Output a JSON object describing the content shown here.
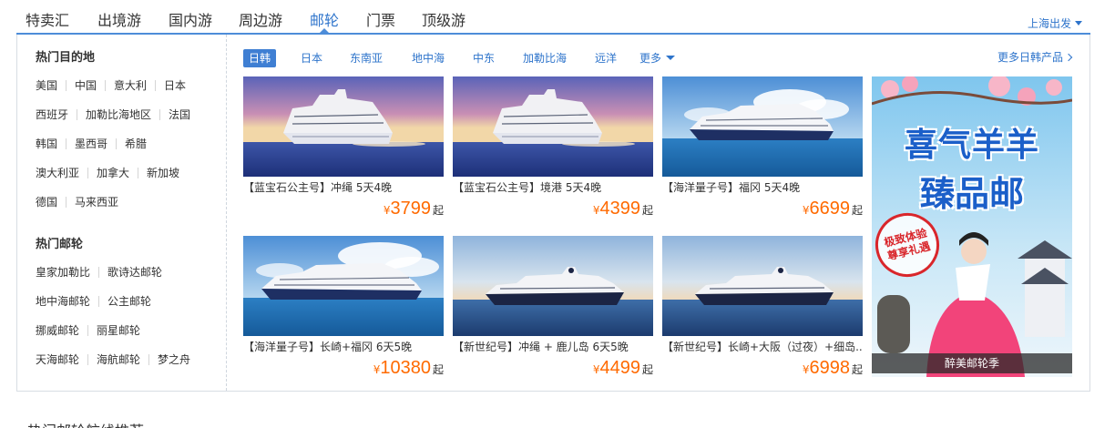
{
  "topnav": {
    "tabs": [
      "特卖汇",
      "出境游",
      "国内游",
      "周边游",
      "邮轮",
      "门票",
      "顶级游"
    ],
    "active_tab": "邮轮",
    "departure": "上海出发"
  },
  "sidebar": {
    "destinations_title": "热门目的地",
    "destinations": [
      [
        "美国",
        "中国",
        "意大利",
        "日本"
      ],
      [
        "西班牙",
        "加勒比海地区",
        "法国"
      ],
      [
        "韩国",
        "墨西哥",
        "希腊"
      ],
      [
        "澳大利亚",
        "加拿大",
        "新加坡"
      ],
      [
        "德国",
        "马来西亚"
      ]
    ],
    "lines_title": "热门邮轮",
    "lines": [
      [
        "皇家加勒比",
        "歌诗达邮轮"
      ],
      [
        "地中海邮轮",
        "公主邮轮"
      ],
      [
        "挪威邮轮",
        "丽星邮轮"
      ],
      [
        "天海邮轮",
        "海航邮轮",
        "梦之舟"
      ]
    ]
  },
  "region_tabs": {
    "items": [
      "日韩",
      "日本",
      "东南亚",
      "地中海",
      "中东",
      "加勒比海",
      "远洋"
    ],
    "active": "日韩",
    "more": "更多",
    "more_products": "更多日韩产品"
  },
  "products": [
    {
      "title": "【蓝宝石公主号】冲绳 5天4晚",
      "currency": "¥",
      "price": "3799",
      "suffix": "起",
      "image": "cruise-ship-sunset"
    },
    {
      "title": "【蓝宝石公主号】境港 5天4晚",
      "currency": "¥",
      "price": "4399",
      "suffix": "起",
      "image": "cruise-ship-sunset"
    },
    {
      "title": "【海洋量子号】福冈 5天4晚",
      "currency": "¥",
      "price": "6699",
      "suffix": "起",
      "image": "cruise-ship-day"
    },
    {
      "title": "【海洋量子号】长崎+福冈 6天5晚",
      "currency": "¥",
      "price": "10380",
      "suffix": "起",
      "image": "cruise-ship-day"
    },
    {
      "title": "【新世纪号】冲绳 + 鹿儿岛 6天5晚",
      "currency": "¥",
      "price": "4499",
      "suffix": "起",
      "image": "cruise-ship-dusk"
    },
    {
      "title": "【新世纪号】长崎+大阪（过夜）+细岛...",
      "currency": "¥",
      "price": "6998",
      "suffix": "起",
      "image": "cruise-ship-dusk"
    }
  ],
  "promo": {
    "headline_1": "喜气羊羊",
    "headline_2": "臻品邮",
    "stamp_line_1": "极致体验",
    "stamp_line_2": "尊享礼遇",
    "caption": "醉美邮轮季"
  },
  "footer_partial_text": "热门邮轮航线推荐",
  "colors": {
    "accent": "#2e74cb",
    "price": "#ff6a00",
    "active_tab_bg": "#3f7fd3"
  }
}
